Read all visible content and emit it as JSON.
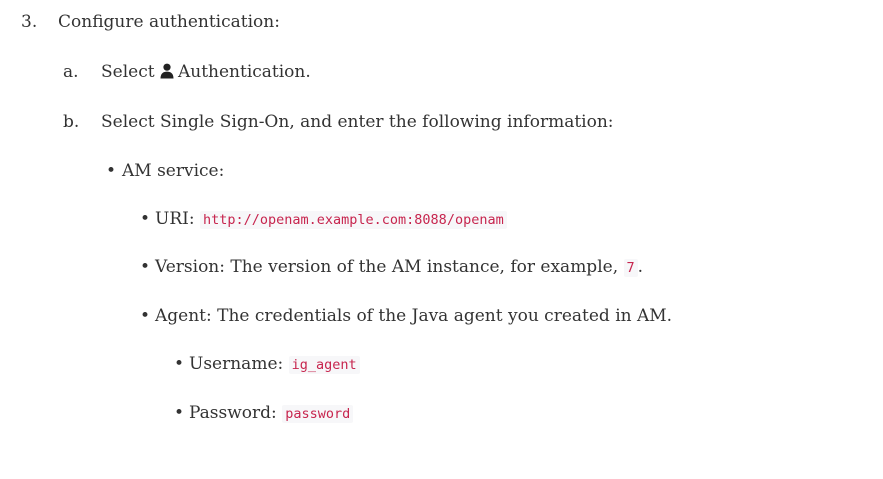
{
  "step3": {
    "marker": "3.",
    "text": "Configure authentication:"
  },
  "step_a": {
    "marker": "a.",
    "prefix": "Select",
    "icon": "user-icon",
    "suffix": "Authentication."
  },
  "step_b": {
    "marker": "b.",
    "text": "Select Single Sign-On, and enter the following information:"
  },
  "am_service": {
    "label": "AM service:"
  },
  "uri": {
    "label": "URI:",
    "value": "http://openam.example.com:8088/openam"
  },
  "version": {
    "label": "Version: The version of the AM instance, for example,",
    "value": "7",
    "end": "."
  },
  "agent": {
    "label": "Agent: The credentials of the Java agent you created in AM."
  },
  "username": {
    "label": "Username:",
    "value": "ig_agent"
  },
  "password": {
    "label": "Password:",
    "value": "password"
  },
  "colors": {
    "text": "#333333",
    "code": "#c7254e",
    "code_bg": "#f7f7f9"
  }
}
